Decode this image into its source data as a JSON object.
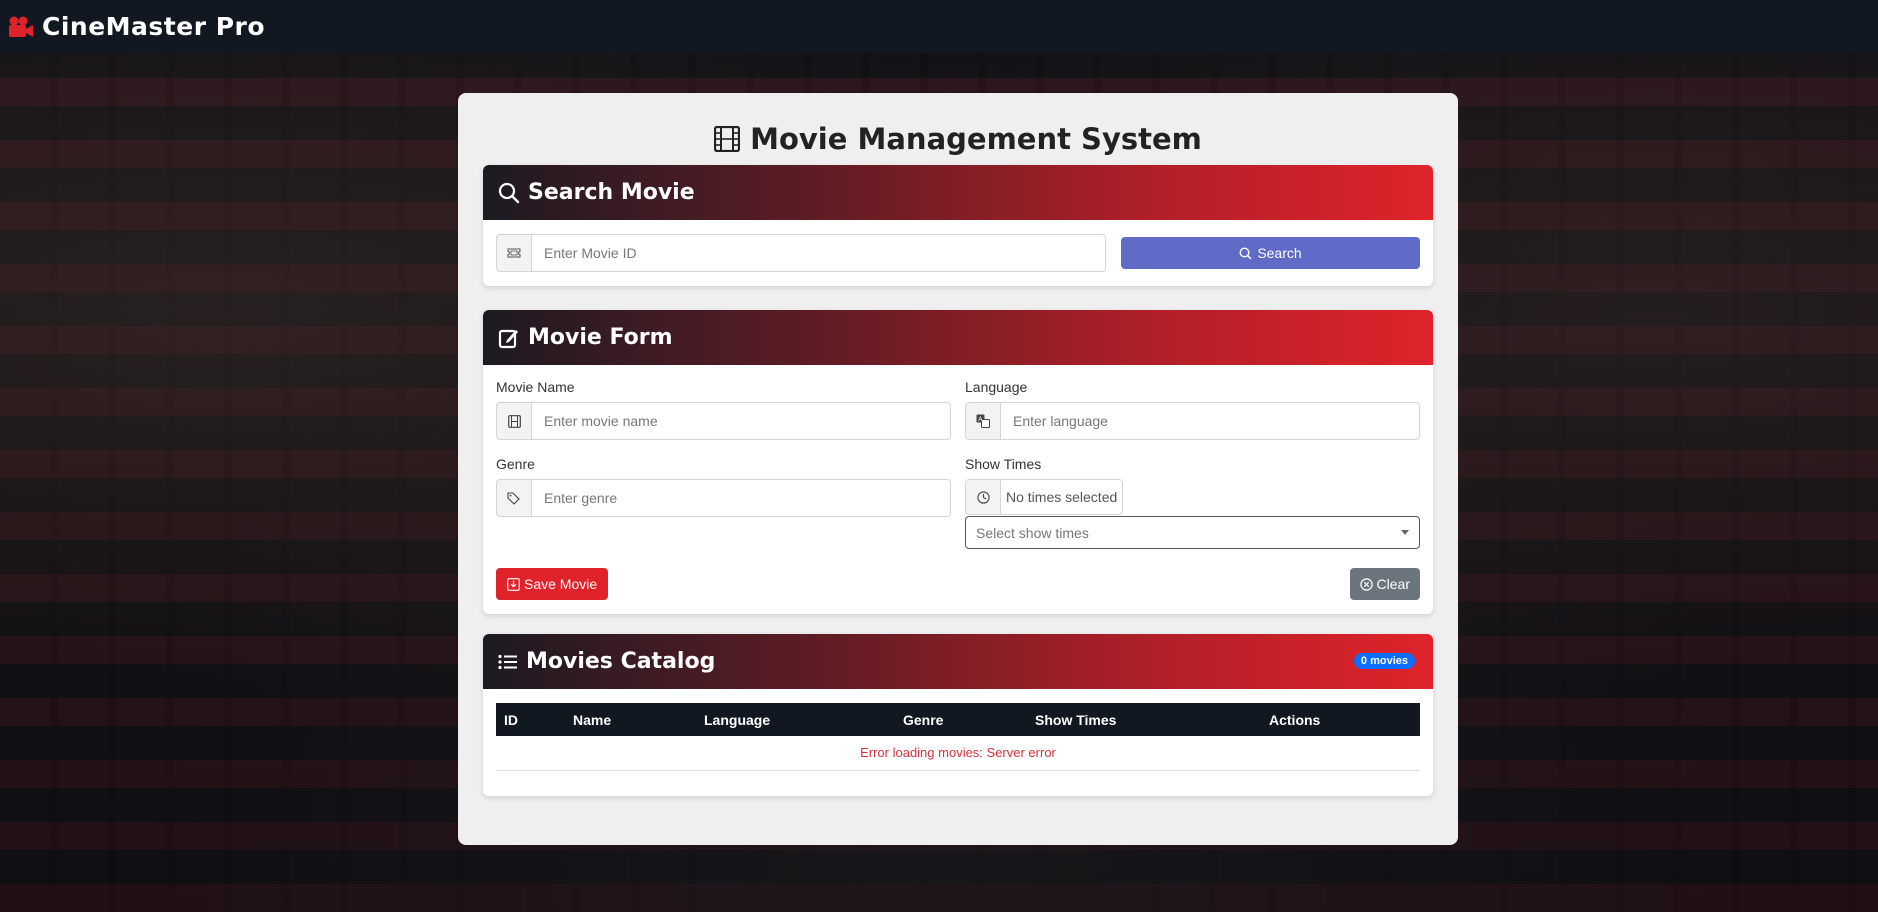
{
  "navbar": {
    "brand": "CineMaster Pro"
  },
  "page": {
    "title": "Movie Management System"
  },
  "search": {
    "title": "Search Movie",
    "placeholder": "Enter Movie ID",
    "button_label": "Search"
  },
  "form": {
    "title": "Movie Form",
    "movie_name_label": "Movie Name",
    "movie_name_placeholder": "Enter movie name",
    "language_label": "Language",
    "language_placeholder": "Enter language",
    "genre_label": "Genre",
    "genre_placeholder": "Enter genre",
    "show_times_label": "Show Times",
    "show_times_status": "No times selected",
    "show_times_select": "Select show times",
    "save_label": "Save Movie",
    "clear_label": "Clear"
  },
  "catalog": {
    "title": "Movies Catalog",
    "count_badge": "0 movies",
    "columns": [
      "ID",
      "Name",
      "Language",
      "Genre",
      "Show Times",
      "Actions"
    ],
    "error_message": "Error loading movies: Server error"
  },
  "colors": {
    "accent_red": "#e0232b",
    "search_button": "#5f6bc6",
    "clear_button": "#6c757d",
    "badge": "#0d6efd",
    "navbar": "#111821"
  }
}
